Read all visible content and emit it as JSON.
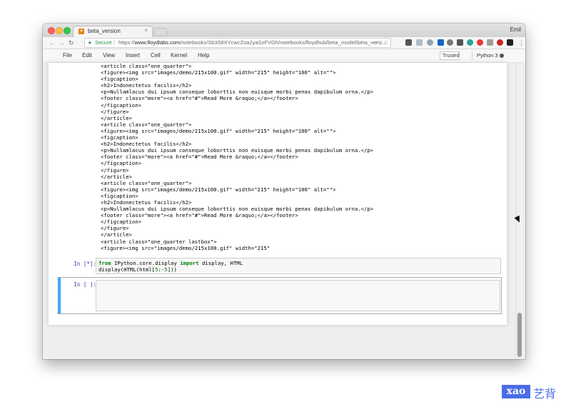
{
  "browser": {
    "tab_title": "beta_version",
    "tab_close": "×",
    "profile_name": "Emil",
    "secure_label": "Secure",
    "url_scheme": "https://",
    "url_host": "www.floydlabs.com",
    "url_path": "/notebooks/Sb3S8XYcwcZoa2yaSzFVGh/notebooks/floydhub/beta_model/beta_versi...",
    "icons": [
      "back-icon",
      "forward-icon",
      "reload-icon",
      "lock-icon",
      "search-icon",
      "star-icon"
    ]
  },
  "menubar": {
    "items": [
      "File",
      "Edit",
      "View",
      "Insert",
      "Cell",
      "Kernel",
      "Help"
    ],
    "trusted": "Trusted",
    "kernel": "Python 3"
  },
  "output": {
    "lines": [
      "<article class=\"one_quarter\">",
      "<figure><img src=\"images/demo/215x100.gif\" width=\"215\" height=\"100\" alt=\"\">",
      "<figcaption>",
      "<h2>Indonectetus facilis</h2>",
      "<p>Nullamlacus dui ipsum conseque loborttis non euisque morbi penas dapibulum orna.</p>",
      "<footer class=\"more\"><a href=\"#\">Read More &raquo;</a></footer>",
      "</figcaption>",
      "</figure>",
      "</article>",
      "<article class=\"one_quarter\">",
      "<figure><img src=\"images/demo/215x100.gif\" width=\"215\" height=\"100\" alt=\"\">",
      "<figcaption>",
      "<h2>Indonectetus facilis</h2>",
      "<p>Nullamlacus dui ipsum conseque loborttis non euisque morbi penas dapibulum orna.</p>",
      "<footer class=\"more\"><a href=\"#\">Read More &raquo;</a></footer>",
      "</figcaption>",
      "</figure>",
      "</article>",
      "<article class=\"one_quarter\">",
      "<figure><img src=\"images/demo/215x100.gif\" width=\"215\" height=\"100\" alt=\"\">",
      "<figcaption>",
      "<h2>Indonectetus facilis</h2>",
      "<p>Nullamlacus dui ipsum conseque loborttis non euisque morbi penas dapibulum orna.</p>",
      "<footer class=\"more\"><a href=\"#\">Read More &raquo;</a></footer>",
      "</figcaption>",
      "</figure>",
      "</article>",
      "<article class=\"one_quarter lastbox\">",
      "<figure><img src=\"images/demo/215x100.gif\" width=\"215\""
    ]
  },
  "cells": {
    "running": {
      "prompt": "In [*]:",
      "line1": {
        "kw1": "from",
        "mod": " IPython.core.display ",
        "kw2": "import",
        "rest": " display, HTML"
      },
      "line2": {
        "pre": "display(HTML(html[",
        "n1": "5",
        "mid": ":-",
        "n2": "5",
        "post": "]))"
      }
    },
    "empty": {
      "prompt": "In [ ]:",
      "value": ""
    }
  },
  "watermark": {
    "box": "xao",
    "text": "艺背"
  },
  "colors": {
    "accent": "#42a5f5",
    "prompt": "#303f9f",
    "keyword": "#008000",
    "secure": "#1e8e3e"
  }
}
